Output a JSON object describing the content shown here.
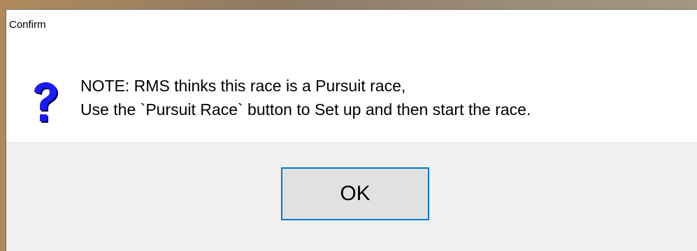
{
  "dialog": {
    "title": "Confirm",
    "icon": "question-icon",
    "message_lines": [
      "NOTE: RMS thinks this race is a Pursuit race,",
      "Use the `Pursuit Race` button to Set up and then start the race."
    ],
    "ok_label": "OK"
  },
  "colors": {
    "accent": "#0078d7",
    "icon_blue": "#1a1aff",
    "footer_bg": "#f0f0f0",
    "button_bg": "#e1e1e1"
  }
}
